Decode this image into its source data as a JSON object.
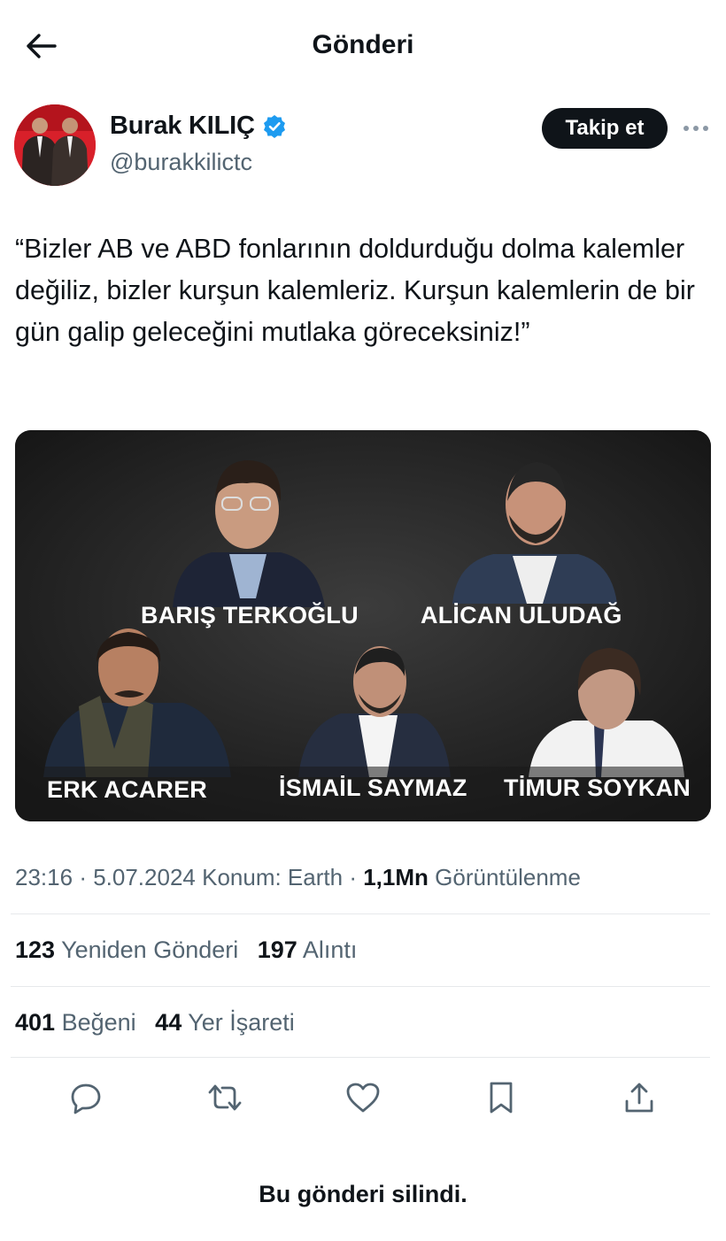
{
  "header": {
    "title": "Gönderi",
    "back_icon": "arrow-left-icon"
  },
  "author": {
    "name": "Burak KILIÇ",
    "handle": "@burakkilictc",
    "verified": true,
    "follow_label": "Takip et",
    "more_icon": "more-horizontal-icon"
  },
  "tweet": {
    "text": "“Bizler AB ve ABD fonlarının doldurduğu dolma kalemler değiliz, bizler kurşun kalemleriz. Kurşun kalemlerin de bir gün galip geleceğini mutlaka göreceksiniz!”"
  },
  "media": {
    "people": [
      {
        "name": "BARIŞ TERKOĞLU"
      },
      {
        "name": "ALİCAN ULUDAĞ"
      },
      {
        "name": "ERK ACARER"
      },
      {
        "name": "İSMAİL SAYMAZ"
      },
      {
        "name": "TİMUR SOYKAN"
      }
    ]
  },
  "meta": {
    "time": "23:16",
    "date": "5.07.2024",
    "location": "Konum: Earth",
    "views_count": "1,1Mn",
    "views_label": "Görüntülenme"
  },
  "stats": {
    "reposts_count": "123",
    "reposts_label": "Yeniden Gönderi",
    "quotes_count": "197",
    "quotes_label": "Alıntı",
    "likes_count": "401",
    "likes_label": "Beğeni",
    "bookmarks_count": "44",
    "bookmarks_label": "Yer İşareti"
  },
  "actions": [
    "reply-icon",
    "repost-icon",
    "like-icon",
    "bookmark-icon",
    "share-icon"
  ],
  "footer": {
    "deleted_notice": "Bu gönderi silindi."
  },
  "colors": {
    "text": "#0f1419",
    "secondary": "#536471",
    "verified": "#1d9bf0",
    "divider": "#e6e9eb",
    "avatar_bg": "#d8202a"
  }
}
